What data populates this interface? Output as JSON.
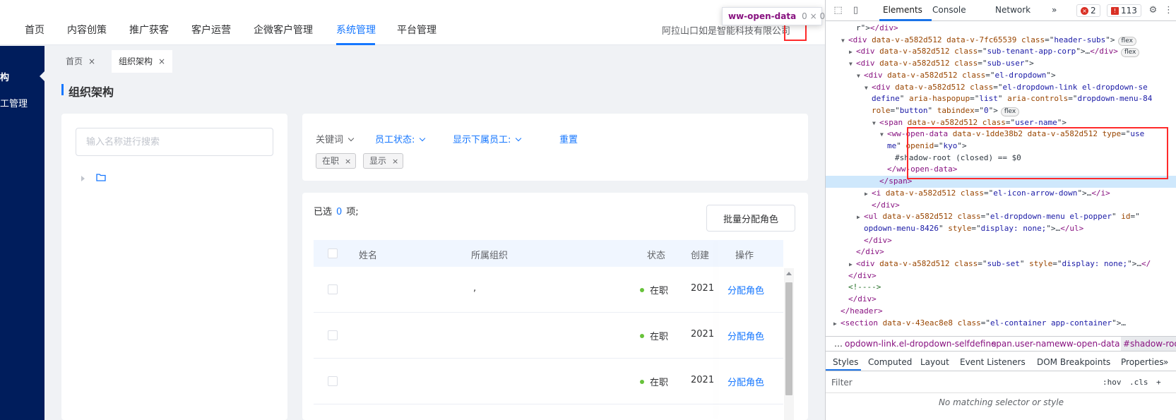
{
  "topnav": {
    "items": [
      "首页",
      "内容创策",
      "推广获客",
      "客户运营",
      "企微客户管理",
      "系统管理",
      "平台管理"
    ],
    "active_index": 5,
    "company": "阿拉山口如是智能科技有限公司"
  },
  "tooltip": {
    "tag": "ww-open-data",
    "dims": "0 × 0"
  },
  "sidebar": {
    "active_label": "构",
    "item2_label": "工管理"
  },
  "tabs": [
    {
      "label": "首页",
      "close": "×"
    },
    {
      "label": "组织架构",
      "close": "×"
    }
  ],
  "tabs_settings_icon": "sliders-icon",
  "page": {
    "title": "组织架构"
  },
  "tree": {
    "search_placeholder": "输入名称进行搜索",
    "folder_icon": "folder-icon"
  },
  "filters": {
    "keyword": "关键词",
    "status": "员工状态:",
    "subordinates": "显示下属员工:",
    "reset": "重置",
    "chips": [
      {
        "label": "在职",
        "close": "×"
      },
      {
        "label": "显示",
        "close": "×"
      }
    ]
  },
  "list": {
    "selected_prefix": "已选",
    "selected_count": "0",
    "selected_suffix": "项;",
    "batch_button": "批量分配角色",
    "columns": [
      "姓名",
      "所属组织",
      "状态",
      "创建",
      "操作"
    ],
    "rows": [
      {
        "name": "",
        "org": ",",
        "status": "在职",
        "created": "2021",
        "action": "分配角色"
      },
      {
        "name": "",
        "org": "",
        "status": "在职",
        "created": "2021",
        "action": "分配角色"
      },
      {
        "name": "",
        "org": "",
        "status": "在职",
        "created": "2021",
        "action": "分配角色"
      }
    ],
    "status_color": "#67c23a",
    "accent": "#1677ff"
  },
  "devtools": {
    "tabs": [
      "Elements",
      "Console",
      "Network"
    ],
    "more": "»",
    "errors": "2",
    "issues": "113",
    "dom_lines": [
      {
        "indent": 1,
        "tri": "",
        "parts": [
          [
            "g",
            "r\">"
          ],
          [
            "t",
            "</div>"
          ]
        ]
      },
      {
        "indent": 0,
        "tri": "▼",
        "parts": [
          [
            "t",
            "<div "
          ],
          [
            "a",
            "data-v-a582d512 data-v-7fc65539 "
          ],
          [
            "a",
            "class"
          ],
          [
            "g",
            "=\""
          ],
          [
            "v",
            "header-subs"
          ],
          [
            "g",
            "\">"
          ]
        ],
        "pill": "flex"
      },
      {
        "indent": 1,
        "tri": "▶",
        "parts": [
          [
            "t",
            "<div "
          ],
          [
            "a",
            "data-v-a582d512 "
          ],
          [
            "a",
            "class"
          ],
          [
            "g",
            "=\""
          ],
          [
            "v",
            "sub-tenant-app-corp"
          ],
          [
            "g",
            "\">…"
          ],
          [
            "t",
            "</div>"
          ]
        ],
        "pill": "flex"
      },
      {
        "indent": 1,
        "tri": "▼",
        "parts": [
          [
            "t",
            "<div "
          ],
          [
            "a",
            "data-v-a582d512 "
          ],
          [
            "a",
            "class"
          ],
          [
            "g",
            "=\""
          ],
          [
            "v",
            "sub-user"
          ],
          [
            "g",
            "\">"
          ]
        ]
      },
      {
        "indent": 2,
        "tri": "▼",
        "parts": [
          [
            "t",
            "<div "
          ],
          [
            "a",
            "data-v-a582d512 "
          ],
          [
            "a",
            "class"
          ],
          [
            "g",
            "=\""
          ],
          [
            "v",
            "el-dropdown"
          ],
          [
            "g",
            "\">"
          ]
        ]
      },
      {
        "indent": 3,
        "tri": "▼",
        "parts": [
          [
            "t",
            "<div "
          ],
          [
            "a",
            "data-v-a582d512 "
          ],
          [
            "a",
            "class"
          ],
          [
            "g",
            "=\""
          ],
          [
            "v",
            "el-dropdown-link el-dropdown-se"
          ]
        ]
      },
      {
        "indent": 3,
        "tri": "",
        "parts": [
          [
            "v",
            "define"
          ],
          [
            "g",
            "\" "
          ],
          [
            "a",
            "aria-haspopup"
          ],
          [
            "g",
            "=\""
          ],
          [
            "v",
            "list"
          ],
          [
            "g",
            "\" "
          ],
          [
            "a",
            "aria-controls"
          ],
          [
            "g",
            "=\""
          ],
          [
            "v",
            "dropdown-menu-84"
          ]
        ]
      },
      {
        "indent": 3,
        "tri": "",
        "parts": [
          [
            "a",
            "role"
          ],
          [
            "g",
            "=\""
          ],
          [
            "v",
            "button"
          ],
          [
            "g",
            "\" "
          ],
          [
            "a",
            "tabindex"
          ],
          [
            "g",
            "=\""
          ],
          [
            "v",
            "0"
          ],
          [
            "g",
            "\">"
          ]
        ],
        "pill": "flex"
      },
      {
        "indent": 4,
        "tri": "▼",
        "parts": [
          [
            "t",
            "<span "
          ],
          [
            "a",
            "data-v-a582d512 "
          ],
          [
            "a",
            "class"
          ],
          [
            "g",
            "=\""
          ],
          [
            "v",
            "user-name"
          ],
          [
            "g",
            "\">"
          ]
        ]
      },
      {
        "indent": 5,
        "tri": "▼",
        "parts": [
          [
            "t",
            "<ww-open-data "
          ],
          [
            "a",
            "data-v-1dde38b2 data-v-a582d512 "
          ],
          [
            "a",
            "type"
          ],
          [
            "g",
            "=\""
          ],
          [
            "v",
            "use"
          ]
        ]
      },
      {
        "indent": 5,
        "tri": "",
        "parts": [
          [
            "v",
            "me"
          ],
          [
            "g",
            "\" "
          ],
          [
            "a",
            "openid"
          ],
          [
            "g",
            "=\""
          ],
          [
            "v",
            "kyo"
          ],
          [
            "g",
            "\">"
          ]
        ]
      },
      {
        "indent": 6,
        "tri": "",
        "parts": [
          [
            "g",
            "#shadow-root (closed) == $0"
          ]
        ]
      },
      {
        "indent": 5,
        "tri": "",
        "parts": [
          [
            "t",
            "</ww-open-data>"
          ]
        ]
      },
      {
        "indent": 4,
        "tri": "",
        "parts": [
          [
            "t",
            "</span>"
          ]
        ]
      },
      {
        "indent": 3,
        "tri": "▶",
        "parts": [
          [
            "t",
            "<i "
          ],
          [
            "a",
            "data-v-a582d512 "
          ],
          [
            "a",
            "class"
          ],
          [
            "g",
            "=\""
          ],
          [
            "v",
            "el-icon-arrow-down"
          ],
          [
            "g",
            "\">…"
          ],
          [
            "t",
            "</i>"
          ]
        ]
      },
      {
        "indent": 3,
        "tri": "",
        "parts": [
          [
            "t",
            "</div>"
          ]
        ]
      },
      {
        "indent": 2,
        "tri": "▶",
        "parts": [
          [
            "t",
            "<ul "
          ],
          [
            "a",
            "data-v-a582d512 "
          ],
          [
            "a",
            "class"
          ],
          [
            "g",
            "=\""
          ],
          [
            "v",
            "el-dropdown-menu el-popper"
          ],
          [
            "g",
            "\" "
          ],
          [
            "a",
            "id"
          ],
          [
            "g",
            "=\""
          ]
        ]
      },
      {
        "indent": 2,
        "tri": "",
        "parts": [
          [
            "v",
            "opdown-menu-8426"
          ],
          [
            "g",
            "\" "
          ],
          [
            "a",
            "style"
          ],
          [
            "g",
            "=\""
          ],
          [
            "v",
            "display: none;"
          ],
          [
            "g",
            "\">…"
          ],
          [
            "t",
            "</ul>"
          ]
        ]
      },
      {
        "indent": 2,
        "tri": "",
        "parts": [
          [
            "t",
            "</div>"
          ]
        ]
      },
      {
        "indent": 1,
        "tri": "",
        "parts": [
          [
            "t",
            "</div>"
          ]
        ]
      },
      {
        "indent": 1,
        "tri": "▶",
        "parts": [
          [
            "t",
            "<div "
          ],
          [
            "a",
            "data-v-a582d512 "
          ],
          [
            "a",
            "class"
          ],
          [
            "g",
            "=\""
          ],
          [
            "v",
            "sub-set"
          ],
          [
            "g",
            "\" "
          ],
          [
            "a",
            "style"
          ],
          [
            "g",
            "=\""
          ],
          [
            "v",
            "display: none;"
          ],
          [
            "g",
            "\">…"
          ],
          [
            "t",
            "</"
          ]
        ]
      },
      {
        "indent": 0,
        "tri": "",
        "parts": [
          [
            "t",
            "</div>"
          ]
        ]
      },
      {
        "indent": 0,
        "tri": "",
        "parts": [
          [
            "c",
            "<!---->"
          ]
        ]
      },
      {
        "indent": 0,
        "tri": "",
        "parts": [
          [
            "t",
            "</div>"
          ]
        ]
      },
      {
        "indent": -1,
        "tri": "",
        "parts": [
          [
            "t",
            "</header>"
          ]
        ]
      },
      {
        "indent": -1,
        "tri": "▶",
        "parts": [
          [
            "t",
            "<section "
          ],
          [
            "a",
            "data-v-43eac8e8 "
          ],
          [
            "a",
            "class"
          ],
          [
            "g",
            "=\""
          ],
          [
            "v",
            "el-container app-container"
          ],
          [
            "g",
            "\">…"
          ]
        ]
      }
    ],
    "breadcrumbs": [
      "…",
      "opdown-link.el-dropdown-selfdefine",
      "span.user-name",
      "ww-open-data",
      "#shadow-root"
    ],
    "subtabs": [
      "Styles",
      "Computed",
      "Layout",
      "Event Listeners",
      "DOM Breakpoints",
      "Properties",
      "»"
    ],
    "filter_placeholder": "Filter",
    "filter_toggles": [
      ":hov",
      ".cls",
      "+"
    ],
    "no_match": "No matching selector or style"
  }
}
